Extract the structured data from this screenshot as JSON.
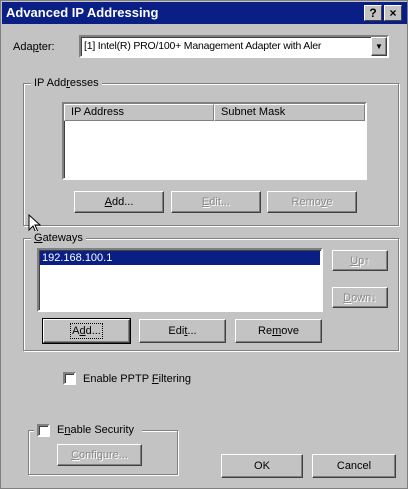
{
  "window": {
    "title": "Advanced IP Addressing",
    "help_button": "?",
    "close_button": "×"
  },
  "adapter": {
    "label": "Adapter:",
    "value": "[1] Intel(R) PRO/100+ Management Adapter with Aler",
    "dropdown_arrow": "▼"
  },
  "ip_addresses": {
    "legend": "IP Addresses",
    "columns": [
      "IP Address",
      "Subnet Mask"
    ],
    "rows": [],
    "buttons": {
      "add": "Add...",
      "edit": "Edit...",
      "remove": "Remove"
    }
  },
  "gateways": {
    "legend": "Gateways",
    "items": [
      "192.168.100.1"
    ],
    "up": "Up↑",
    "down": "Down↓",
    "buttons": {
      "add": "Add...",
      "edit": "Edit...",
      "remove": "Remove"
    }
  },
  "pptp": {
    "label": "Enable PPTP Filtering",
    "checked": false
  },
  "security": {
    "label": "Enable Security",
    "checked": false,
    "configure": "Configure..."
  },
  "dialog_buttons": {
    "ok": "OK",
    "cancel": "Cancel"
  },
  "colors": {
    "titlebar": "#0a1f86",
    "face": "#c3c3c3",
    "selection": "#0a1f86"
  },
  "icons": [
    "help-icon",
    "close-icon",
    "dropdown-arrow-icon",
    "mouse-cursor-icon"
  ]
}
